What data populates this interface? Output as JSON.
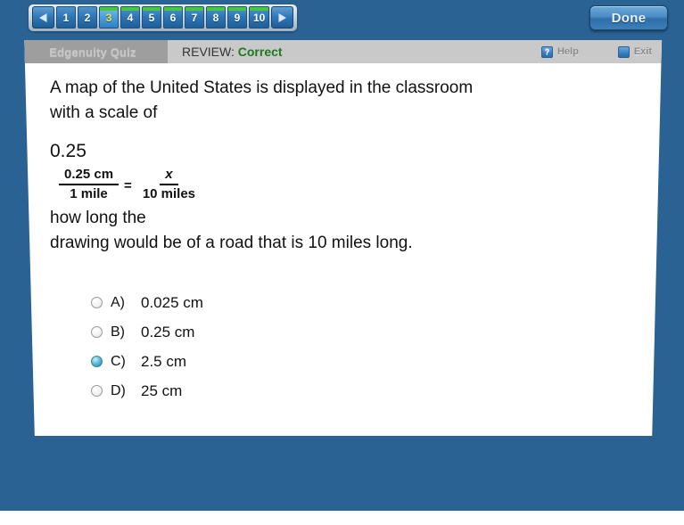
{
  "nav": {
    "prev_label": "◀",
    "next_label": "▶",
    "items": [
      {
        "label": "1",
        "completed": false,
        "current": false
      },
      {
        "label": "2",
        "completed": false,
        "current": false
      },
      {
        "label": "3",
        "completed": true,
        "current": true
      },
      {
        "label": "4",
        "completed": true,
        "current": false
      },
      {
        "label": "5",
        "completed": true,
        "current": false
      },
      {
        "label": "6",
        "completed": true,
        "current": false
      },
      {
        "label": "7",
        "completed": true,
        "current": false
      },
      {
        "label": "8",
        "completed": true,
        "current": false
      },
      {
        "label": "9",
        "completed": true,
        "current": false
      },
      {
        "label": "10",
        "completed": true,
        "current": false
      }
    ],
    "done_label": "Done"
  },
  "header": {
    "brand": "Edgenuity Quiz",
    "review_prefix": "REVIEW:",
    "review_verdict": "Correct",
    "help_label": "Help",
    "help_icon_glyph": "?",
    "exit_label": "Exit"
  },
  "question": {
    "line1": "A map of the United States is displayed in the classroom",
    "line2": "with a scale of",
    "scale_value": "0.25",
    "equation": {
      "left_numerator": "0.25 cm",
      "left_denominator": "1 mile",
      "operator": "=",
      "right_numerator": "x",
      "right_denominator": "10 miles"
    },
    "line3": "how long the",
    "line4": "drawing would be of a road that is 10 miles long."
  },
  "answers": [
    {
      "letter": "A)",
      "text": "0.025 cm",
      "selected": false
    },
    {
      "letter": "B)",
      "text": "0.25 cm",
      "selected": false
    },
    {
      "letter": "C)",
      "text": "2.5 cm",
      "selected": true
    },
    {
      "letter": "D)",
      "text": "25 cm",
      "selected": false
    }
  ],
  "colors": {
    "app_background": "#2a6293",
    "completed_marker": "#44c93f",
    "current_item_text": "#f3e14a",
    "correct_text": "#1f7a1f",
    "selected_radio": "#2e9ec8"
  }
}
